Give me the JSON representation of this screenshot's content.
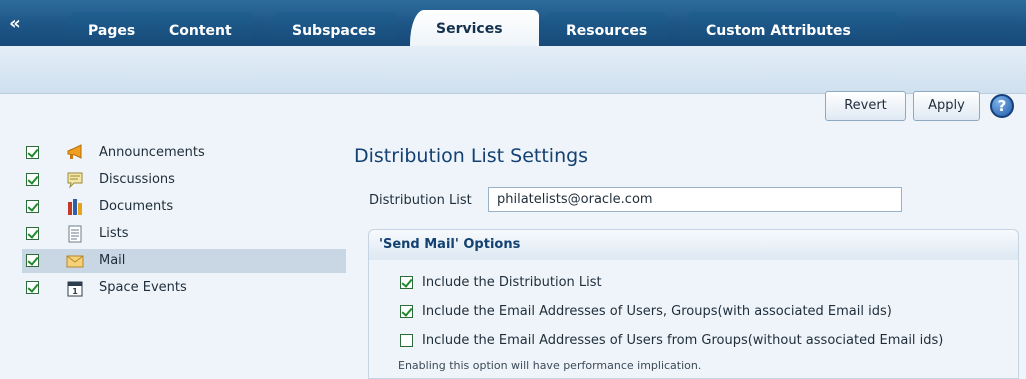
{
  "tabs": [
    {
      "label": "Pages",
      "active": false
    },
    {
      "label": "Content",
      "active": false
    },
    {
      "label": "Subspaces",
      "active": false
    },
    {
      "label": "Services",
      "active": true
    },
    {
      "label": "Resources",
      "active": false
    },
    {
      "label": "Custom Attributes",
      "active": false
    }
  ],
  "collapse_glyph": "«",
  "toolbar": {
    "revert_label": "Revert",
    "apply_label": "Apply",
    "help_glyph": "?"
  },
  "services": [
    {
      "label": "Announcements",
      "checked": true,
      "icon": "megaphone-icon",
      "selected": false
    },
    {
      "label": "Discussions",
      "checked": true,
      "icon": "speech-bubble-icon",
      "selected": false
    },
    {
      "label": "Documents",
      "checked": true,
      "icon": "books-icon",
      "selected": false
    },
    {
      "label": "Lists",
      "checked": true,
      "icon": "list-icon",
      "selected": false
    },
    {
      "label": "Mail",
      "checked": true,
      "icon": "envelope-icon",
      "selected": true
    },
    {
      "label": "Space Events",
      "checked": true,
      "icon": "calendar-icon",
      "selected": false
    }
  ],
  "settings": {
    "title": "Distribution List Settings",
    "distribution_list_label": "Distribution List",
    "distribution_list_value": "philatelists@oracle.com"
  },
  "send_mail": {
    "title": "'Send Mail' Options",
    "options": [
      {
        "label": "Include the Distribution List",
        "checked": true
      },
      {
        "label": "Include the Email Addresses of Users, Groups(with associated Email ids)",
        "checked": true
      },
      {
        "label": "Include the Email Addresses of Users from Groups(without associated Email ids)",
        "checked": false
      }
    ],
    "note": "Enabling this option will have performance implication."
  },
  "colors": {
    "tab_bar": "#1d5585",
    "accent": "#134172",
    "check": "#1f8a2c",
    "selected_row": "#c9d6e3"
  }
}
